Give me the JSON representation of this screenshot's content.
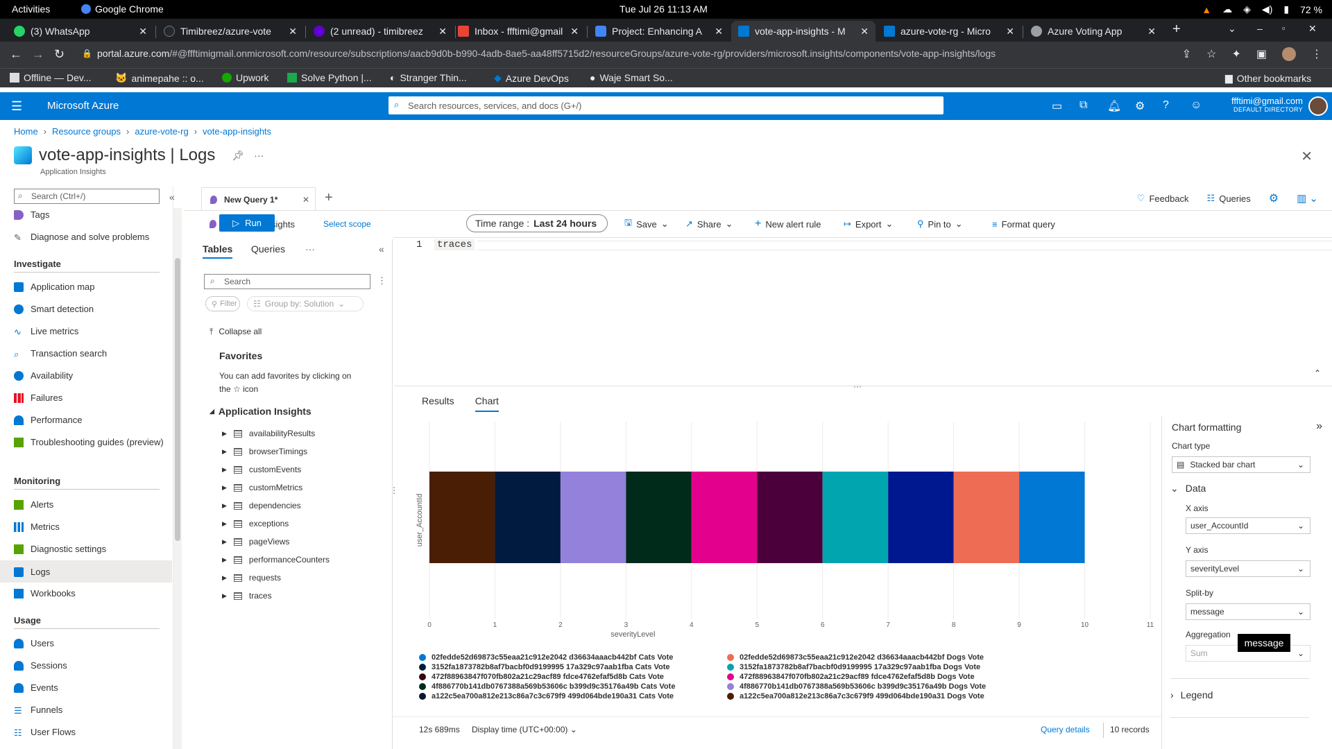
{
  "os_bar": {
    "activities": "Activities",
    "app": "Google Chrome",
    "clock": "Tue Jul 26  11:13 AM",
    "battery": "72 %"
  },
  "browser": {
    "tabs": [
      {
        "title": "(3) WhatsApp",
        "icon_color": "#25d366"
      },
      {
        "title": "Timibreez/azure-vote",
        "icon_color": "#24292f"
      },
      {
        "title": "(2 unread) - timibreez",
        "icon_color": "#6001d2"
      },
      {
        "title": "Inbox - ffftimi@gmail",
        "icon_color": "#ea4335"
      },
      {
        "title": "Project: Enhancing A",
        "icon_color": "#4285f4"
      },
      {
        "title": "vote-app-insights - M",
        "icon_color": "#0078d4"
      },
      {
        "title": "azure-vote-rg - Micro",
        "icon_color": "#0078d4"
      },
      {
        "title": "Azure Voting App",
        "icon_color": "#9aa0a6"
      }
    ],
    "url_host": "portal.azure.com",
    "url_rest": "/#@ffftimigmail.onmicrosoft.com/resource/subscriptions/aacb9d0b-b990-4adb-8ae5-aa48ff5715d2/resourceGroups/azure-vote-rg/providers/microsoft.insights/components/vote-app-insights/logs",
    "bookmarks": [
      "Offline — Dev...",
      "animepahe :: o...",
      "Upwork",
      "Solve Python |...",
      "Stranger Thin...",
      "Azure DevOps",
      "Waje Smart So..."
    ],
    "other_bookmarks": "Other bookmarks"
  },
  "azure": {
    "brand": "Microsoft Azure",
    "search_placeholder": "Search resources, services, and docs (G+/)",
    "user_email": "ffftimi@gmail.com",
    "user_dir": "DEFAULT DIRECTORY"
  },
  "breadcrumb": [
    "Home",
    "Resource groups",
    "azure-vote-rg",
    "vote-app-insights"
  ],
  "page": {
    "title": "vote-app-insights | Logs",
    "subtitle": "Application Insights"
  },
  "leftnav": {
    "search_placeholder": "Search (Ctrl+/)",
    "items_top": [
      {
        "label": "Tags",
        "color": "#8661c5"
      },
      {
        "label": "Diagnose and solve problems",
        "color": "#605e5c"
      }
    ],
    "investigate_header": "Investigate",
    "investigate": [
      {
        "label": "Application map",
        "color": "#0078d4"
      },
      {
        "label": "Smart detection",
        "color": "#0078d4"
      },
      {
        "label": "Live metrics",
        "color": "#0078d4"
      },
      {
        "label": "Transaction search",
        "color": "#0078d4"
      },
      {
        "label": "Availability",
        "color": "#0078d4"
      },
      {
        "label": "Failures",
        "color": "#e81123"
      },
      {
        "label": "Performance",
        "color": "#0078d4"
      },
      {
        "label": "Troubleshooting guides (preview)",
        "color": "#57a300"
      }
    ],
    "monitoring_header": "Monitoring",
    "monitoring": [
      {
        "label": "Alerts",
        "color": "#57a300"
      },
      {
        "label": "Metrics",
        "color": "#0078d4"
      },
      {
        "label": "Diagnostic settings",
        "color": "#57a300"
      },
      {
        "label": "Logs",
        "color": "#0078d4"
      },
      {
        "label": "Workbooks",
        "color": "#0078d4"
      }
    ],
    "usage_header": "Usage",
    "usage": [
      {
        "label": "Users",
        "color": "#0078d4"
      },
      {
        "label": "Sessions",
        "color": "#0078d4"
      },
      {
        "label": "Events",
        "color": "#0078d4"
      },
      {
        "label": "Funnels",
        "color": "#0078d4"
      },
      {
        "label": "User Flows",
        "color": "#0078d4"
      }
    ]
  },
  "query": {
    "tab": "New Query 1*",
    "feedback": "Feedback",
    "queries": "Queries",
    "scope": "vote-app-insights",
    "select_scope": "Select scope",
    "run": "Run",
    "time_range_label": "Time range :",
    "time_range_value": "Last 24 hours",
    "save": "Save",
    "share": "Share",
    "new_alert": "New alert rule",
    "export": "Export",
    "pin_to": "Pin to",
    "format": "Format query",
    "line_no": "1",
    "code": "traces"
  },
  "schema": {
    "tabs": [
      "Tables",
      "Queries"
    ],
    "search_placeholder": "Search",
    "filter": "Filter",
    "group_by": "Group by: Solution",
    "collapse_all": "Collapse all",
    "favorites_header": "Favorites",
    "favorites_text_1": "You can add favorites by clicking on",
    "favorites_text_2": "the ☆ icon",
    "group_header": "Application Insights",
    "tables": [
      "availabilityResults",
      "browserTimings",
      "customEvents",
      "customMetrics",
      "dependencies",
      "exceptions",
      "pageViews",
      "performanceCounters",
      "requests",
      "traces"
    ]
  },
  "results": {
    "tabs": [
      "Results",
      "Chart"
    ]
  },
  "chart_data": {
    "type": "bar",
    "orientation": "horizontal-stacked",
    "xlabel": "severityLevel",
    "ylabel": "user_AccountId",
    "xlim": [
      0,
      11
    ],
    "xticks": [
      0,
      1,
      2,
      3,
      4,
      5,
      6,
      7,
      8,
      9,
      10,
      11
    ],
    "grid": true,
    "legend_position": "bottom",
    "series": [
      {
        "name": "02fedde52d69873c55eaa21c912e2042 d36634aaacb442bf Cats Vote",
        "value": 1,
        "color": "#0078d4"
      },
      {
        "name": "3152fa1873782b8af7bacbf0d9199995 17a329c97aab1fba Cats Vote",
        "value": 1,
        "color": "#001d3f"
      },
      {
        "name": "472f88963847f070fb802a21c29acf89 fdce4762efaf5d8b Cats Vote",
        "value": 1,
        "color": "#3b0509"
      },
      {
        "name": "4f886770b141db0767388a569b53606c b399d9c35176a49b Cats Vote",
        "value": 1,
        "color": "#002b1a"
      },
      {
        "name": "a122c5ea700a812e213c86a7c3c679f9 499d064bde190a31 Cats Vote",
        "value": 1,
        "color": "#0c1832"
      },
      {
        "name": "02fedde52d69873c55eaa21c912e2042 d36634aaacb442bf Dogs Vote",
        "value": 1,
        "color": "#ee6c54"
      },
      {
        "name": "3152fa1873782b8af7bacbf0d9199995 17a329c97aab1fba Dogs Vote",
        "value": 1,
        "color": "#00a5b0"
      },
      {
        "name": "472f88963847f070fb802a21c29acf89 fdce4762efaf5d8b Dogs Vote",
        "value": 1,
        "color": "#e3008c"
      },
      {
        "name": "4f886770b141db0767388a569b53606c b399d9c35176a49b Dogs Vote",
        "value": 1,
        "color": "#9381db"
      },
      {
        "name": "a122c5ea700a812e213c86a7c3c679f9 499d064bde190a31 Dogs Vote",
        "value": 1,
        "color": "#4a1e04"
      }
    ],
    "stack_colors_left_to_right": [
      "#4a1e04",
      "#011a40",
      "#9381db",
      "#002b1a",
      "#e3008c",
      "#4b003b",
      "#00a5b0",
      "#00188f",
      "#ee6c54",
      "#0078d4"
    ]
  },
  "status": {
    "time": "12s 689ms",
    "display_time": "Display time (UTC+00:00)",
    "query_details": "Query details",
    "records": "10 records"
  },
  "formatting": {
    "title": "Chart formatting",
    "chart_type_label": "Chart type",
    "chart_type": "Stacked bar chart",
    "data_header": "Data",
    "x_axis_label": "X axis",
    "x_axis": "user_AccountId",
    "y_axis_label": "Y axis",
    "y_axis": "severityLevel",
    "split_label": "Split-by",
    "split": "message",
    "agg_label": "Aggregation",
    "agg": "Sum",
    "legend_header": "Legend",
    "tooltip": "message"
  }
}
